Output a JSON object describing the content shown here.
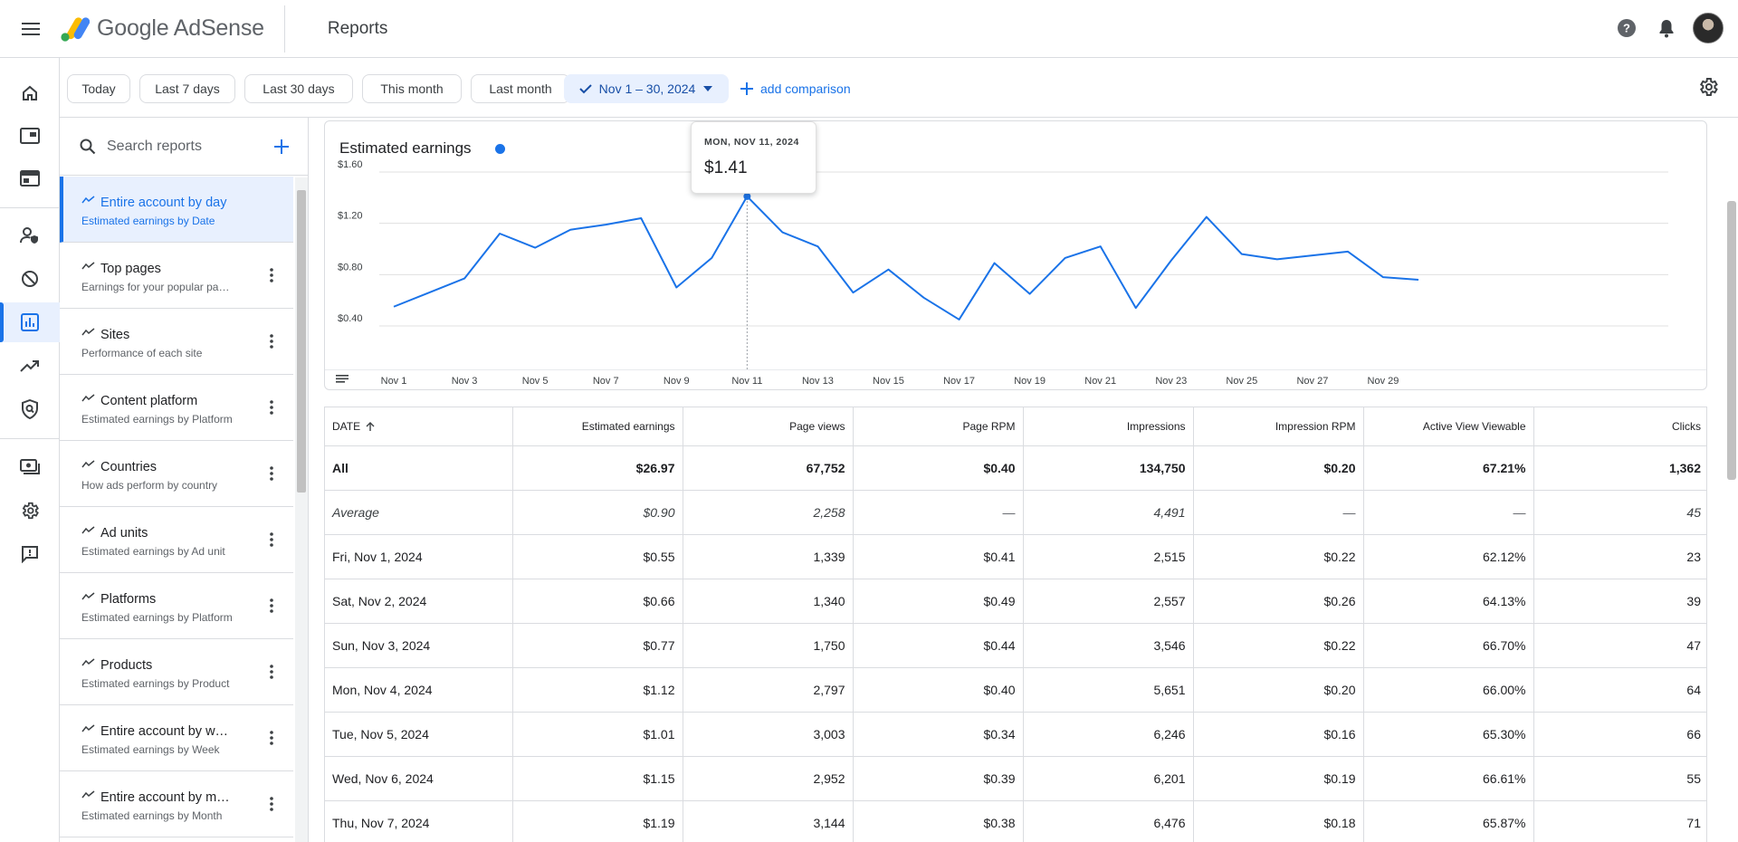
{
  "app": {
    "brand": "Google AdSense",
    "page_title": "Reports"
  },
  "filters": {
    "chips": [
      "Today",
      "Last 7 days",
      "Last 30 days",
      "This month",
      "Last month"
    ],
    "selected_range": "Nov 1 – 30, 2024",
    "add_comparison": "add comparison"
  },
  "sidebar": {
    "search_placeholder": "Search reports",
    "items": [
      {
        "title": "Entire account by day",
        "subtitle": "Estimated earnings by Date"
      },
      {
        "title": "Top pages",
        "subtitle": "Earnings for your popular pages"
      },
      {
        "title": "Sites",
        "subtitle": "Performance of each site"
      },
      {
        "title": "Content platform",
        "subtitle": "Estimated earnings by Platform"
      },
      {
        "title": "Countries",
        "subtitle": "How ads perform by country"
      },
      {
        "title": "Ad units",
        "subtitle": "Estimated earnings by Ad unit"
      },
      {
        "title": "Platforms",
        "subtitle": "Estimated earnings by Platform"
      },
      {
        "title": "Products",
        "subtitle": "Estimated earnings by Product"
      },
      {
        "title": "Entire account by week",
        "subtitle": "Estimated earnings by Week"
      },
      {
        "title": "Entire account by month",
        "subtitle": "Estimated earnings by Month"
      }
    ]
  },
  "tooltip": {
    "date": "MON, NOV 11, 2024",
    "value": "$1.41"
  },
  "chart_data": {
    "type": "line",
    "title": "Estimated earnings",
    "x": [
      "Nov 1",
      "Nov 2",
      "Nov 3",
      "Nov 4",
      "Nov 5",
      "Nov 6",
      "Nov 7",
      "Nov 8",
      "Nov 9",
      "Nov 10",
      "Nov 11",
      "Nov 12",
      "Nov 13",
      "Nov 14",
      "Nov 15",
      "Nov 16",
      "Nov 17",
      "Nov 18",
      "Nov 19",
      "Nov 20",
      "Nov 21",
      "Nov 22",
      "Nov 23",
      "Nov 24",
      "Nov 25",
      "Nov 26",
      "Nov 27",
      "Nov 28",
      "Nov 29",
      "Nov 30"
    ],
    "x_tick_labels": [
      "Nov 1",
      "Nov 3",
      "Nov 5",
      "Nov 7",
      "Nov 9",
      "Nov 11",
      "Nov 13",
      "Nov 15",
      "Nov 17",
      "Nov 19",
      "Nov 21",
      "Nov 23",
      "Nov 25",
      "Nov 27",
      "Nov 29"
    ],
    "series": [
      {
        "values": [
          0.55,
          0.66,
          0.77,
          1.12,
          1.01,
          1.15,
          1.19,
          1.24,
          0.7,
          0.93,
          1.41,
          1.13,
          1.02,
          0.66,
          0.84,
          0.62,
          0.45,
          0.89,
          0.65,
          0.93,
          1.02,
          0.54,
          0.91,
          1.25,
          0.96,
          0.92,
          0.95,
          0.98,
          0.78,
          0.76
        ]
      }
    ],
    "y_ticks": [
      "$0.40",
      "$0.80",
      "$1.20",
      "$1.60"
    ],
    "ylim": [
      0.4,
      1.6
    ],
    "grid": true,
    "highlight_index": 10
  },
  "table": {
    "columns": [
      "DATE",
      "Estimated earnings",
      "Page views",
      "Page RPM",
      "Impressions",
      "Impression RPM",
      "Active View Viewable",
      "Clicks"
    ],
    "total": [
      "All",
      "$26.97",
      "67,752",
      "$0.40",
      "134,750",
      "$0.20",
      "67.21%",
      "1,362"
    ],
    "average": [
      "Average",
      "$0.90",
      "2,258",
      "—",
      "4,491",
      "—",
      "—",
      "45"
    ],
    "rows": [
      [
        "Fri, Nov 1, 2024",
        "$0.55",
        "1,339",
        "$0.41",
        "2,515",
        "$0.22",
        "62.12%",
        "23"
      ],
      [
        "Sat, Nov 2, 2024",
        "$0.66",
        "1,340",
        "$0.49",
        "2,557",
        "$0.26",
        "64.13%",
        "39"
      ],
      [
        "Sun, Nov 3, 2024",
        "$0.77",
        "1,750",
        "$0.44",
        "3,546",
        "$0.22",
        "66.70%",
        "47"
      ],
      [
        "Mon, Nov 4, 2024",
        "$1.12",
        "2,797",
        "$0.40",
        "5,651",
        "$0.20",
        "66.00%",
        "64"
      ],
      [
        "Tue, Nov 5, 2024",
        "$1.01",
        "3,003",
        "$0.34",
        "6,246",
        "$0.16",
        "65.30%",
        "66"
      ],
      [
        "Wed, Nov 6, 2024",
        "$1.15",
        "2,952",
        "$0.39",
        "6,201",
        "$0.19",
        "66.61%",
        "55"
      ],
      [
        "Thu, Nov 7, 2024",
        "$1.19",
        "3,144",
        "$0.38",
        "6,476",
        "$0.18",
        "65.87%",
        "71"
      ]
    ]
  }
}
